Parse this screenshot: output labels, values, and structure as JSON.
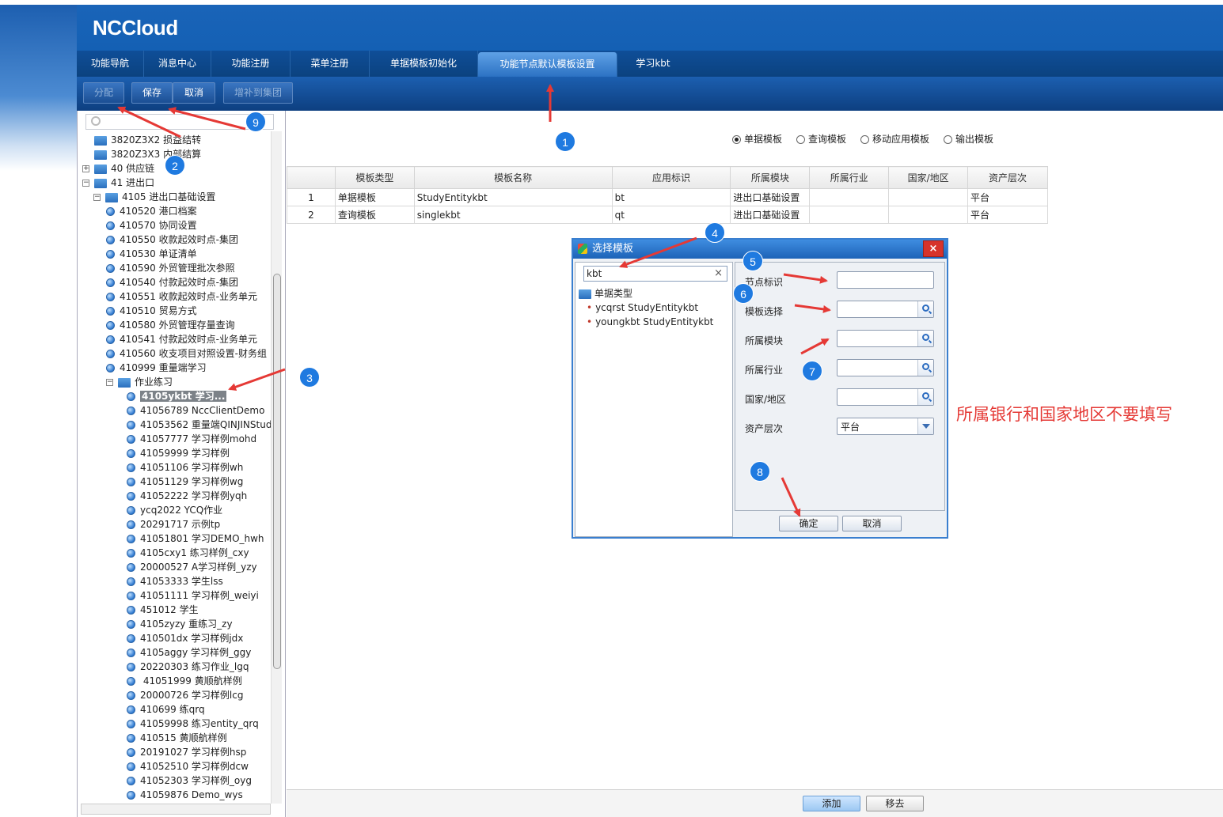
{
  "app": {
    "logo": "NCCloud"
  },
  "tabs": [
    {
      "label": "功能导航",
      "active": false
    },
    {
      "label": "消息中心",
      "active": false
    },
    {
      "label": "功能注册",
      "active": false
    },
    {
      "label": "菜单注册",
      "active": false
    },
    {
      "label": "单据模板初始化",
      "active": false
    },
    {
      "label": "功能节点默认模板设置",
      "active": true
    },
    {
      "label": "学习kbt",
      "active": false
    }
  ],
  "toolbar": {
    "assign_label": "分配",
    "save_label": "保存",
    "cancel_label": "取消",
    "supplement_label": "增补到集团"
  },
  "tree": {
    "search_placeholder": "",
    "nodes": [
      {
        "label": "3820Z3X2  损益结转",
        "type": "folder",
        "level": 0,
        "expand": ""
      },
      {
        "label": "3820Z3X3  内部结算",
        "type": "folder",
        "level": 0,
        "expand": ""
      },
      {
        "label": "40  供应链",
        "type": "folder",
        "level": 0,
        "expand": "+"
      },
      {
        "label": "41  进出口",
        "type": "folder",
        "level": 0,
        "expand": "−"
      },
      {
        "label": "4105  进出口基础设置",
        "type": "folder",
        "level": 1,
        "expand": "−"
      },
      {
        "label": "410520  港口档案",
        "type": "leaf",
        "level": 2
      },
      {
        "label": "410570  协同设置",
        "type": "leaf",
        "level": 2
      },
      {
        "label": "410550  收款起效时点-集团",
        "type": "leaf",
        "level": 2
      },
      {
        "label": "410530  单证清单",
        "type": "leaf",
        "level": 2
      },
      {
        "label": "410590  外贸管理批次参照",
        "type": "leaf",
        "level": 2
      },
      {
        "label": "410540  付款起效时点-集团",
        "type": "leaf",
        "level": 2
      },
      {
        "label": "410551  收款起效时点-业务单元",
        "type": "leaf",
        "level": 2
      },
      {
        "label": "410510  贸易方式",
        "type": "leaf",
        "level": 2
      },
      {
        "label": "410580  外贸管理存量查询",
        "type": "leaf",
        "level": 2
      },
      {
        "label": "410541  付款起效时点-业务单元",
        "type": "leaf",
        "level": 2
      },
      {
        "label": "410560  收支项目对照设置-财务组",
        "type": "leaf",
        "level": 2
      },
      {
        "label": "410999  重量端学习",
        "type": "leaf",
        "level": 2
      },
      {
        "label": "作业练习",
        "type": "folder",
        "level": 2,
        "expand": "−"
      },
      {
        "label": "4105ykbt  学习...",
        "type": "leaf",
        "level": 3,
        "selected": true
      },
      {
        "label": "41056789  NccClientDemo",
        "type": "leaf",
        "level": 3
      },
      {
        "label": "41053562  重量端QINJINStud",
        "type": "leaf",
        "level": 3
      },
      {
        "label": "41057777  学习样例mohd",
        "type": "leaf",
        "level": 3
      },
      {
        "label": "41059999  学习样例",
        "type": "leaf",
        "level": 3
      },
      {
        "label": "41051106  学习样例wh",
        "type": "leaf",
        "level": 3
      },
      {
        "label": "41051129  学习样例wg",
        "type": "leaf",
        "level": 3
      },
      {
        "label": "41052222  学习样例yqh",
        "type": "leaf",
        "level": 3
      },
      {
        "label": "ycq2022  YCQ作业",
        "type": "leaf",
        "level": 3
      },
      {
        "label": "20291717  示例tp",
        "type": "leaf",
        "level": 3
      },
      {
        "label": "41051801  学习DEMO_hwh",
        "type": "leaf",
        "level": 3
      },
      {
        "label": "4105cxy1  练习样例_cxy",
        "type": "leaf",
        "level": 3
      },
      {
        "label": "20000527  A学习样例_yzy",
        "type": "leaf",
        "level": 3
      },
      {
        "label": "41053333  学生lss",
        "type": "leaf",
        "level": 3
      },
      {
        "label": "41051111  学习样例_weiyi",
        "type": "leaf",
        "level": 3
      },
      {
        "label": "451012  学生",
        "type": "leaf",
        "level": 3
      },
      {
        "label": "4105zyzy  重练习_zy",
        "type": "leaf",
        "level": 3
      },
      {
        "label": "410501dx  学习样例jdx",
        "type": "leaf",
        "level": 3
      },
      {
        "label": "4105aggy  学习样例_ggy",
        "type": "leaf",
        "level": 3
      },
      {
        "label": "20220303  练习作业_lgq",
        "type": "leaf",
        "level": 3
      },
      {
        "label": " 41051999  黄顺航样例",
        "type": "leaf",
        "level": 3
      },
      {
        "label": "20000726  学习样例lcg",
        "type": "leaf",
        "level": 3
      },
      {
        "label": "410699  练qrq",
        "type": "leaf",
        "level": 3
      },
      {
        "label": "41059998  练习entity_qrq",
        "type": "leaf",
        "level": 3
      },
      {
        "label": "410515  黄顺航样例",
        "type": "leaf",
        "level": 3
      },
      {
        "label": "20191027  学习样例hsp",
        "type": "leaf",
        "level": 3
      },
      {
        "label": "41052510  学习样例dcw",
        "type": "leaf",
        "level": 3
      },
      {
        "label": "41052303  学习样例_oyg",
        "type": "leaf",
        "level": 3
      },
      {
        "label": "41059876  Demo_wys",
        "type": "leaf",
        "level": 3
      }
    ]
  },
  "template_types": {
    "options": [
      "单据模板",
      "查询模板",
      "移动应用模板",
      "输出模板"
    ],
    "selected": "单据模板"
  },
  "grid": {
    "columns": [
      "",
      "模板类型",
      "模板名称",
      "应用标识",
      "所属模块",
      "所属行业",
      "国家/地区",
      "资产层次"
    ],
    "rows": [
      [
        "1",
        "单据模板",
        "StudyEntitykbt",
        "bt",
        "进出口基础设置",
        "",
        "",
        "平台"
      ],
      [
        "2",
        "查询模板",
        "singlekbt",
        "qt",
        "进出口基础设置",
        "",
        "",
        "平台"
      ]
    ]
  },
  "bottom": {
    "add_label": "添加",
    "remove_label": "移去"
  },
  "dialog": {
    "title": "选择模板",
    "close": "×",
    "search_value": "kbt",
    "clear": "×",
    "tree_root": "单据类型",
    "tree_items": [
      "ycqrst StudyEntitykbt",
      "youngkbt StudyEntitykbt"
    ],
    "fields": {
      "node_id_label": "节点标识",
      "template_label": "模板选择",
      "module_label": "所属模块",
      "industry_label": "所属行业",
      "country_label": "国家/地区",
      "asset_label": "资产层次",
      "asset_value": "平台"
    },
    "ok_label": "确定",
    "cancel_label": "取消"
  },
  "callouts": [
    "1",
    "2",
    "3",
    "4",
    "5",
    "6",
    "7",
    "8",
    "9"
  ],
  "note": "所属银行和国家地区不要填写",
  "colors": {
    "accent": "#1460b4",
    "callout": "#1f7ae0",
    "arrow": "#e53935"
  }
}
